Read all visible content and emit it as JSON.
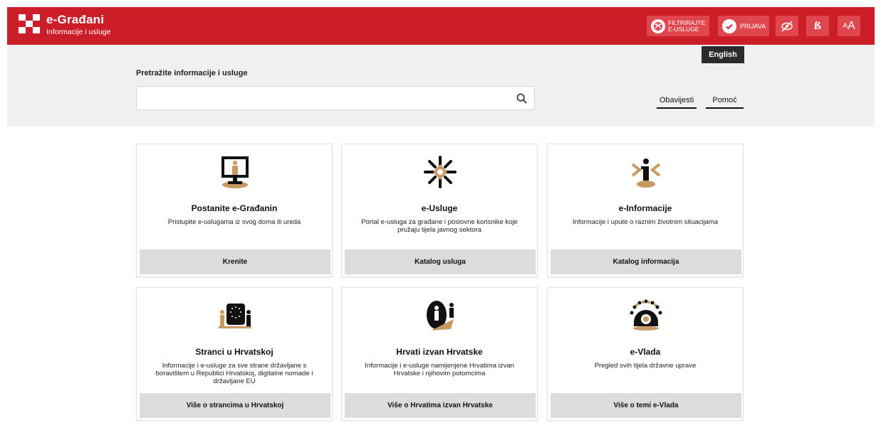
{
  "header": {
    "brand_title": "e-Građani",
    "brand_subtitle": "Informacije i usluge",
    "filter_line1": "FILTRIRAJTE",
    "filter_line2": "E-USLUGE",
    "login_label": "PRIJAVA",
    "dyslexia_label": "ß",
    "font_small": "A",
    "font_big": "A"
  },
  "language": {
    "label": "English"
  },
  "search": {
    "label": "Pretražite informacije i usluge",
    "value": "",
    "placeholder": ""
  },
  "links": {
    "notices": "Obavijesti",
    "help": "Pomoć"
  },
  "cards": [
    {
      "title": "Postanite e-Građanin",
      "desc": "Pristupite e-uslugama iz svog doma ili ureda",
      "cta": "Krenite",
      "icon": "computer-person-icon"
    },
    {
      "title": "e-Usluge",
      "desc": "Portal e-usluga za građane i poslovne korisnike koje pružaju tijela javnog sektora",
      "cta": "Katalog usluga",
      "icon": "services-star-icon"
    },
    {
      "title": "e-Informacije",
      "desc": "Informacije i upute o raznim životnim situacijama",
      "cta": "Katalog informacija",
      "icon": "info-icon"
    },
    {
      "title": "Stranci u Hrvatskoj",
      "desc": "Informacije i e-usluge za sve strane državljane s boravištem u Republici Hrvatskoj, digitalne nomade i državljane EU",
      "cta": "Više o strancima u Hrvatskoj",
      "icon": "eu-flag-people-icon"
    },
    {
      "title": "Hrvati izvan Hrvatske",
      "desc": "Informacije i e-usluge namijenjene Hrvatima izvan Hrvatske i njihovim potomcima",
      "cta": "Više o Hrvatima izvan Hrvatske",
      "icon": "people-abroad-icon"
    },
    {
      "title": "e-Vlada",
      "desc": "Pregled svih tijela državne uprave",
      "cta": "Više o temi e-Vlada",
      "icon": "government-circle-icon"
    }
  ],
  "colors": {
    "header": "#cc1e28",
    "header_button": "#e0464e",
    "band": "#f0f0f0",
    "cta": "#dcdcdc",
    "icon_accent": "#c89a62"
  }
}
